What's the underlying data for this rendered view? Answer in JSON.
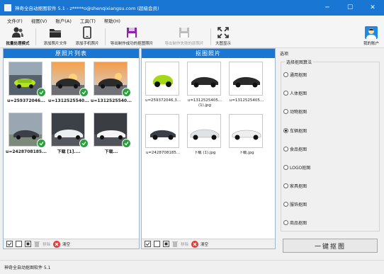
{
  "window": {
    "title": "神奇全自动抠图软件 5.1 - z*****o@shenqixiangsu.com (超级会员)",
    "minimize": "─",
    "maximize": "☐",
    "close": "✕"
  },
  "menu": [
    "文件(F)",
    "视图(V)",
    "账户(A)",
    "工具(T)",
    "帮助(H)"
  ],
  "toolbar": {
    "batch": "批量处理模式",
    "add_file": "添加照片文件",
    "add_phone": "添加手机照片",
    "export_success": "导出制作成功的抠图照片",
    "export_failed": "导出制作失败的原照片",
    "fullscreen": "大图显示",
    "account": "我的账户"
  },
  "left_panel": {
    "title": "原照片列表",
    "items": [
      {
        "caption": "u=259372046..."
      },
      {
        "caption": "u=1312525540..."
      },
      {
        "caption": "u=1312525540..."
      },
      {
        "caption": "u=2428708185..."
      },
      {
        "caption": "下载 [1]...."
      },
      {
        "caption": "下载..."
      }
    ]
  },
  "middle_panel": {
    "title": "抠图照片",
    "items": [
      {
        "caption": "u=259372046,3...",
        "caption2": ""
      },
      {
        "caption": "u=1312525405...",
        "caption2": "(1).jpg"
      },
      {
        "caption": "u=1312525405...",
        "caption2": ""
      },
      {
        "caption": "u=2428708185...",
        "caption2": ""
      },
      {
        "caption": "下载 (1).jpg",
        "caption2": ""
      },
      {
        "caption": "下载.jpg",
        "caption2": ""
      }
    ]
  },
  "footer": {
    "remove": "移除",
    "clear": "清空"
  },
  "options": {
    "title": "选项",
    "group": "选择抠图算法",
    "algorithms": [
      {
        "label": "通用抠图",
        "selected": false
      },
      {
        "label": "人体抠图",
        "selected": false
      },
      {
        "label": "动物抠图",
        "selected": false
      },
      {
        "label": "车辆抠图",
        "selected": true
      },
      {
        "label": "食品抠图",
        "selected": false
      },
      {
        "label": "LOGO抠图",
        "selected": false
      },
      {
        "label": "家具抠图",
        "selected": false
      },
      {
        "label": "服饰抠图",
        "selected": false
      },
      {
        "label": "商品抠图",
        "selected": false
      }
    ],
    "action": "一键抠图"
  },
  "status": "神奇全自动抠图软件 5.1",
  "colors": {
    "accent": "#1976d2",
    "success": "#26a33a",
    "danger": "#e53935"
  }
}
